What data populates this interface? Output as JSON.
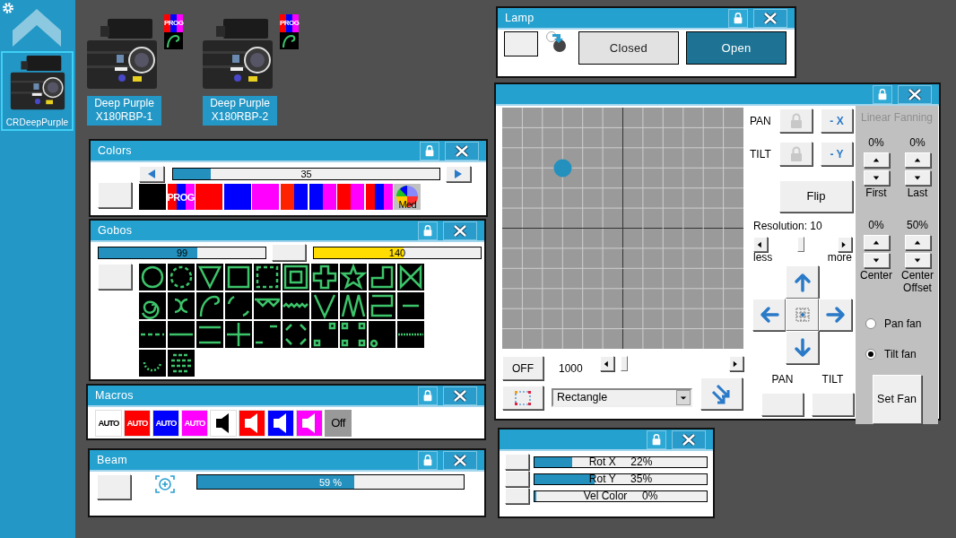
{
  "sidebar": {
    "fixture": {
      "label": "CRDeepPurple",
      "selected": true
    }
  },
  "fixtures": [
    {
      "lines": [
        "Deep Purple",
        "X180RBP-1"
      ],
      "badge": "PROG"
    },
    {
      "lines": [
        "Deep Purple",
        "X180RBP-2"
      ],
      "badge": "PROG"
    }
  ],
  "colors": {
    "title": "Colors",
    "slider": {
      "level": 0.14,
      "reading": "35"
    },
    "swatches": [
      {
        "kind": "solid",
        "stripes": [
          {
            "color": "#000000"
          }
        ]
      },
      {
        "kind": "label",
        "text": "PROG",
        "stripes": [
          {
            "color": "#ff0000"
          },
          {
            "color": "#0000ff"
          },
          {
            "color": "#ff00ff"
          }
        ]
      },
      {
        "kind": "solid",
        "stripes": [
          {
            "color": "#ff0000"
          }
        ]
      },
      {
        "kind": "solid",
        "stripes": [
          {
            "color": "#0000ff"
          }
        ]
      },
      {
        "kind": "solid",
        "stripes": [
          {
            "color": "#ff00ff"
          }
        ]
      },
      {
        "kind": "solid",
        "stripes": [
          {
            "color": "#ff2200"
          },
          {
            "color": "#0000ff"
          }
        ]
      },
      {
        "kind": "solid",
        "stripes": [
          {
            "color": "#0000ff"
          },
          {
            "color": "#ff00ff"
          }
        ]
      },
      {
        "kind": "solid",
        "stripes": [
          {
            "color": "#ff0000"
          },
          {
            "color": "#ff00ff"
          }
        ]
      },
      {
        "kind": "solid",
        "stripes": [
          {
            "color": "#ff0000"
          },
          {
            "color": "#0000ff"
          },
          {
            "color": "#ff00ff"
          }
        ]
      },
      {
        "kind": "wheel",
        "text": "Med"
      }
    ]
  },
  "gobos": {
    "title": "Gobos",
    "slider": {
      "level": 0.59,
      "reading": "99"
    },
    "speed": {
      "level": 0.54,
      "reading": "140",
      "color": "#ffdd00"
    }
  },
  "macros": {
    "title": "Macros",
    "items": [
      {
        "kind": "auto",
        "text": "AUTO",
        "color": "#ffffff"
      },
      {
        "kind": "auto",
        "text": "AUTO",
        "color": "#ff0000"
      },
      {
        "kind": "auto",
        "text": "AUTO",
        "color": "#0000ff"
      },
      {
        "kind": "auto",
        "text": "AUTO",
        "color": "#ff00ff"
      },
      {
        "kind": "sound",
        "color": "#ffffff"
      },
      {
        "kind": "sound",
        "color": "#ff0000"
      },
      {
        "kind": "sound",
        "color": "#0000ff"
      },
      {
        "kind": "sound",
        "color": "#ff00ff"
      },
      {
        "kind": "text",
        "text": "Off",
        "color": "#999999"
      }
    ]
  },
  "beam": {
    "title": "Beam",
    "slider": {
      "level": 0.59,
      "reading": "59 %"
    }
  },
  "lamp": {
    "title": "Lamp",
    "buttons": [
      {
        "label": "Closed",
        "selected": false
      },
      {
        "label": "Open",
        "selected": true
      }
    ]
  },
  "position": {
    "axes": [
      {
        "label": "PAN",
        "invert": "- X"
      },
      {
        "label": "TILT",
        "invert": "- Y"
      }
    ],
    "flip": "Flip",
    "resolution": {
      "label": "Resolution: 10",
      "level": 0.47,
      "less": "less",
      "more": "more"
    },
    "off": "OFF",
    "speed": {
      "reading": "1000",
      "level": 0.06
    },
    "shape": "Rectangle",
    "channels": [
      "PAN",
      "TILT"
    ],
    "fanning": {
      "title": "Linear Fanning",
      "disabled": true,
      "spinners": [
        {
          "reading": "0%",
          "label": "First"
        },
        {
          "reading": "0%",
          "label": "Last"
        },
        {
          "reading": "0%",
          "label": "Center"
        },
        {
          "reading": "50%",
          "label": "Center Offset"
        }
      ],
      "modes": [
        {
          "label": "Pan fan",
          "selected": false
        },
        {
          "label": "Tilt fan",
          "selected": true
        }
      ],
      "button": "Set Fan"
    }
  },
  "rotation": {
    "rows": [
      {
        "label": "Rot X",
        "reading": "22%",
        "level": 0.22
      },
      {
        "label": "Rot Y",
        "reading": "35%",
        "level": 0.35
      },
      {
        "label": "Vel Color",
        "reading": "0%",
        "level": 0.0
      }
    ]
  }
}
